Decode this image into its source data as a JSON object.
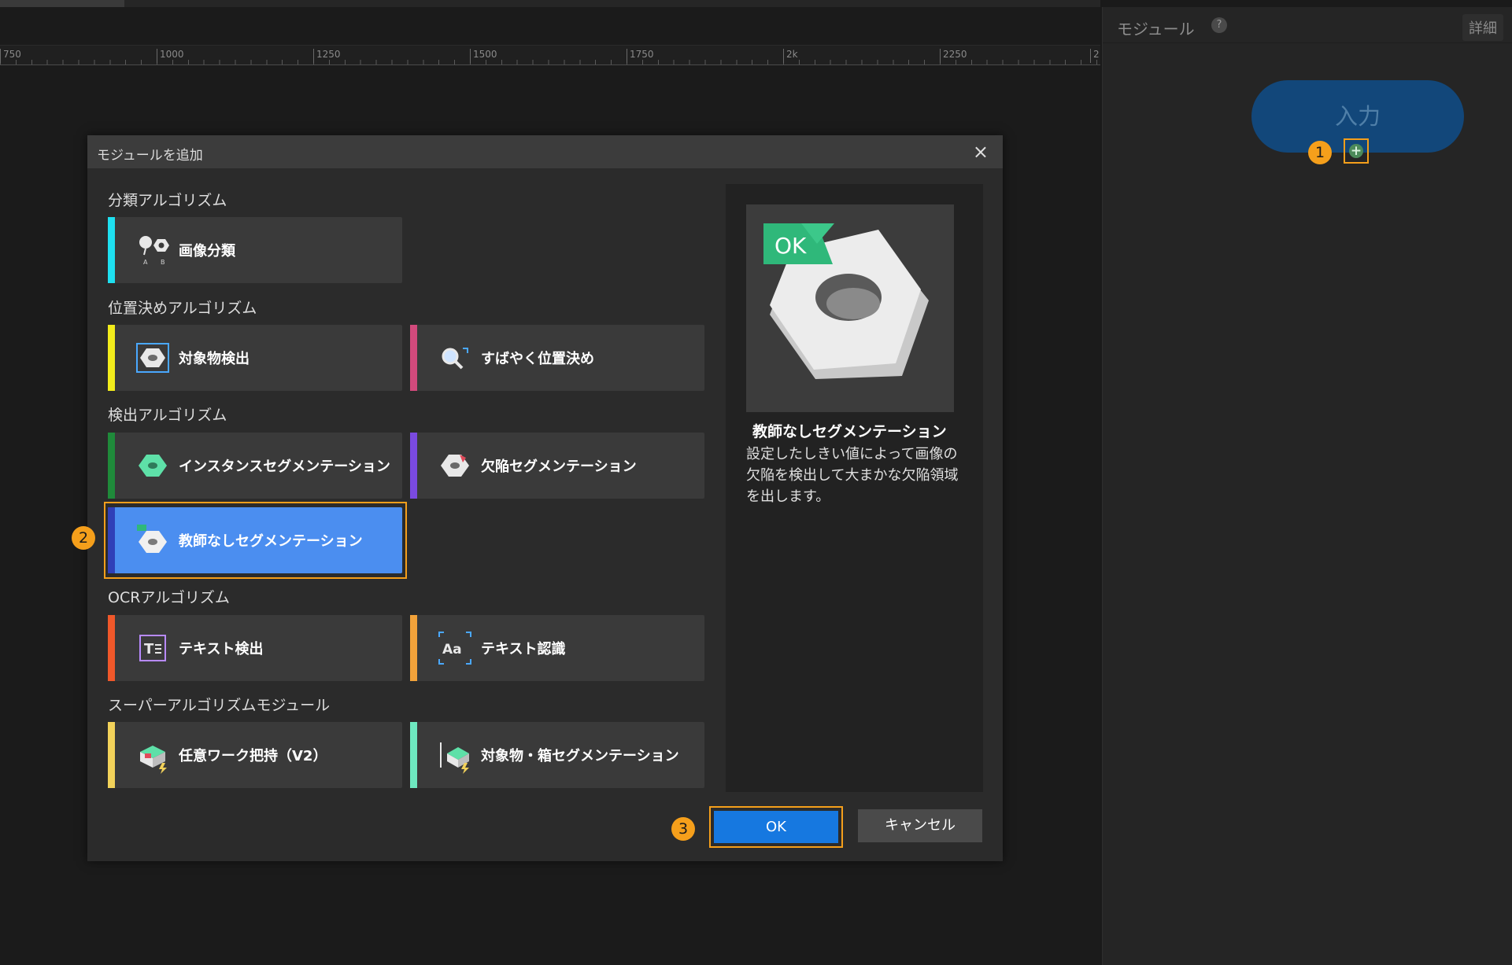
{
  "ruler": {
    "ticks": [
      "750",
      "1000",
      "1250",
      "1500",
      "1750",
      "2k",
      "2250",
      "2"
    ]
  },
  "right_panel": {
    "title": "モジュール",
    "help": "?",
    "detail_label": "詳細",
    "input_node_label": "入力",
    "add_icon": "+"
  },
  "steps": {
    "one": "1",
    "two": "2",
    "three": "3"
  },
  "dialog": {
    "title": "モジュールを追加",
    "close": "×",
    "sections": [
      {
        "title": "分類アルゴリズム"
      },
      {
        "title": "位置決めアルゴリズム"
      },
      {
        "title": "検出アルゴリズム"
      },
      {
        "title": "OCRアルゴリズム"
      },
      {
        "title": "スーパーアルゴリズムモジュール"
      }
    ],
    "modules": {
      "image_classification": {
        "label": "画像分類",
        "color": "#1ee0f0"
      },
      "object_detection": {
        "label": "対象物検出",
        "color": "#f2ec1b"
      },
      "fast_positioning": {
        "label": "すばやく位置決め",
        "color": "#d24a7c"
      },
      "instance_segmentation": {
        "label": "インスタンスセグメンテーション",
        "color": "#1f8a3a"
      },
      "defect_segmentation": {
        "label": "欠陥セグメンテーション",
        "color": "#7a4ae0"
      },
      "unsupervised_segmentation": {
        "label": "教師なしセグメンテーション",
        "color": "#2f3fb8"
      },
      "text_detection": {
        "label": "テキスト検出",
        "color": "#f0582a"
      },
      "text_recognition": {
        "label": "テキスト認識",
        "color": "#f2a23a"
      },
      "grasping": {
        "label": "任意ワーク把持（V2）",
        "color": "#f2d25a"
      },
      "box_segmentation": {
        "label": "対象物・箱セグメンテーション",
        "color": "#6ee8c0"
      }
    },
    "preview": {
      "ok_tag": "OK",
      "name": "教師なしセグメンテーション",
      "description": "設定したしきい値によって画像の欠陥を検出して大まかな欠陥領域を出します。"
    },
    "ok_label": "OK",
    "cancel_label": "キャンセル"
  }
}
